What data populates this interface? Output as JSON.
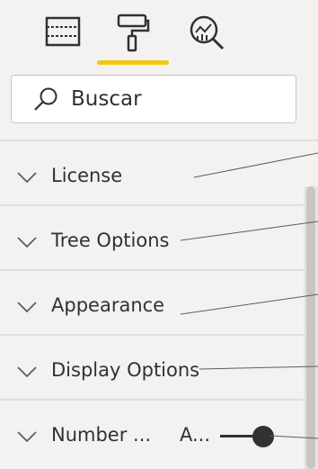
{
  "toolbar": {
    "tools": [
      {
        "icon": "fields-grid-icon"
      },
      {
        "icon": "paint-roller-icon",
        "active": true
      },
      {
        "icon": "analytics-magnifier-icon"
      }
    ],
    "active_color": "#f2c811"
  },
  "search": {
    "text": "Buscar",
    "icon": "search-icon"
  },
  "sections": [
    {
      "label": "License",
      "icon": "chevron-down-icon"
    },
    {
      "label": "Tree Options",
      "icon": "chevron-down-icon"
    },
    {
      "label": "Appearance",
      "icon": "chevron-down-icon"
    },
    {
      "label": "Display Options",
      "icon": "chevron-down-icon"
    },
    {
      "label": "Number ...",
      "value": "A...",
      "icon": "chevron-down-icon",
      "slider_level": 0.9
    }
  ]
}
